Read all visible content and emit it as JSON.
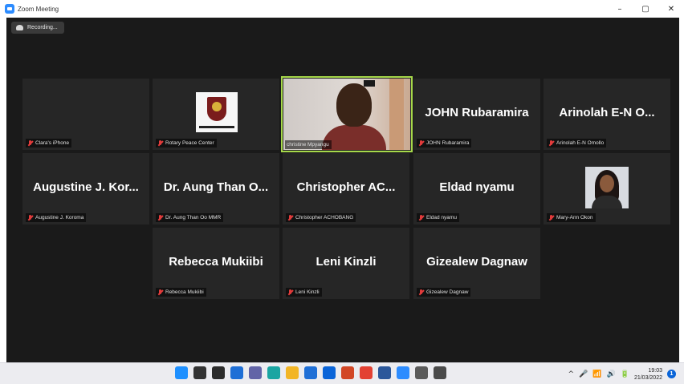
{
  "window": {
    "title": "Zoom Meeting",
    "controls": {
      "minimize": "–",
      "maximize": "▢",
      "close": "✕"
    }
  },
  "meeting": {
    "recording_label": "Recording...",
    "accent_color": "#a6d84a"
  },
  "participants": [
    {
      "display": "",
      "label": "Clara's iPhone",
      "kind": "blank",
      "muted": true
    },
    {
      "display": "",
      "label": "Rotary Peace Center",
      "kind": "logo",
      "muted": true
    },
    {
      "display": "",
      "label": "christine Mpyangu",
      "kind": "video",
      "muted": false,
      "active_speaker": true
    },
    {
      "display": "JOHN Rubaramira",
      "label": "JOHN Rubaramira",
      "kind": "name",
      "muted": true
    },
    {
      "display": "Arinolah E-N O...",
      "label": "Arinolah E-N Omollo",
      "kind": "name",
      "muted": true
    },
    {
      "display": "Augustine J. Kor...",
      "label": "Augustine J. Koroma",
      "kind": "name",
      "muted": true
    },
    {
      "display": "Dr. Aung Than O...",
      "label": "Dr. Aung Than Oo MMR",
      "kind": "name",
      "muted": true
    },
    {
      "display": "Christopher AC...",
      "label": "Christopher ACHOBANG",
      "kind": "name",
      "muted": true
    },
    {
      "display": "Eldad nyamu",
      "label": "Eldad nyamu",
      "kind": "name",
      "muted": true
    },
    {
      "display": "",
      "label": "Mary-Ann Okon",
      "kind": "photo",
      "muted": true
    },
    {
      "display": "Rebecca Mukiibi",
      "label": "Rebecca Mukiibi",
      "kind": "name",
      "muted": true
    },
    {
      "display": "Leni Kinzli",
      "label": "Leni Kinzli",
      "kind": "name",
      "muted": true
    },
    {
      "display": "Gizealew Dagnaw",
      "label": "Gizealew Dagnaw",
      "kind": "name",
      "muted": true
    }
  ],
  "taskbar": {
    "apps": [
      {
        "name": "start-icon",
        "color": "#1e90ff"
      },
      {
        "name": "search-icon",
        "color": "#333333"
      },
      {
        "name": "task-view-icon",
        "color": "#2b2b2b"
      },
      {
        "name": "widgets-icon",
        "color": "#1f6fd6"
      },
      {
        "name": "teams-chat-icon",
        "color": "#6264a7"
      },
      {
        "name": "edge-icon",
        "color": "#1aa5a2"
      },
      {
        "name": "file-explorer-icon",
        "color": "#f2b525"
      },
      {
        "name": "store-icon",
        "color": "#1f6fd6"
      },
      {
        "name": "mail-icon",
        "color": "#0a64d8"
      },
      {
        "name": "powerpoint-icon",
        "color": "#d24726"
      },
      {
        "name": "chrome-icon",
        "color": "#e34133"
      },
      {
        "name": "word-icon",
        "color": "#2b579a"
      },
      {
        "name": "zoom-icon",
        "color": "#2d8cff"
      },
      {
        "name": "settings-icon",
        "color": "#5a5a5a"
      },
      {
        "name": "calculator-icon",
        "color": "#4a4a4a"
      }
    ],
    "tray_glyphs": [
      "^",
      "🎤",
      "📶",
      "🔊",
      "🔋"
    ],
    "time": "19:03",
    "date": "21/03/2022",
    "notification_count": "1"
  }
}
